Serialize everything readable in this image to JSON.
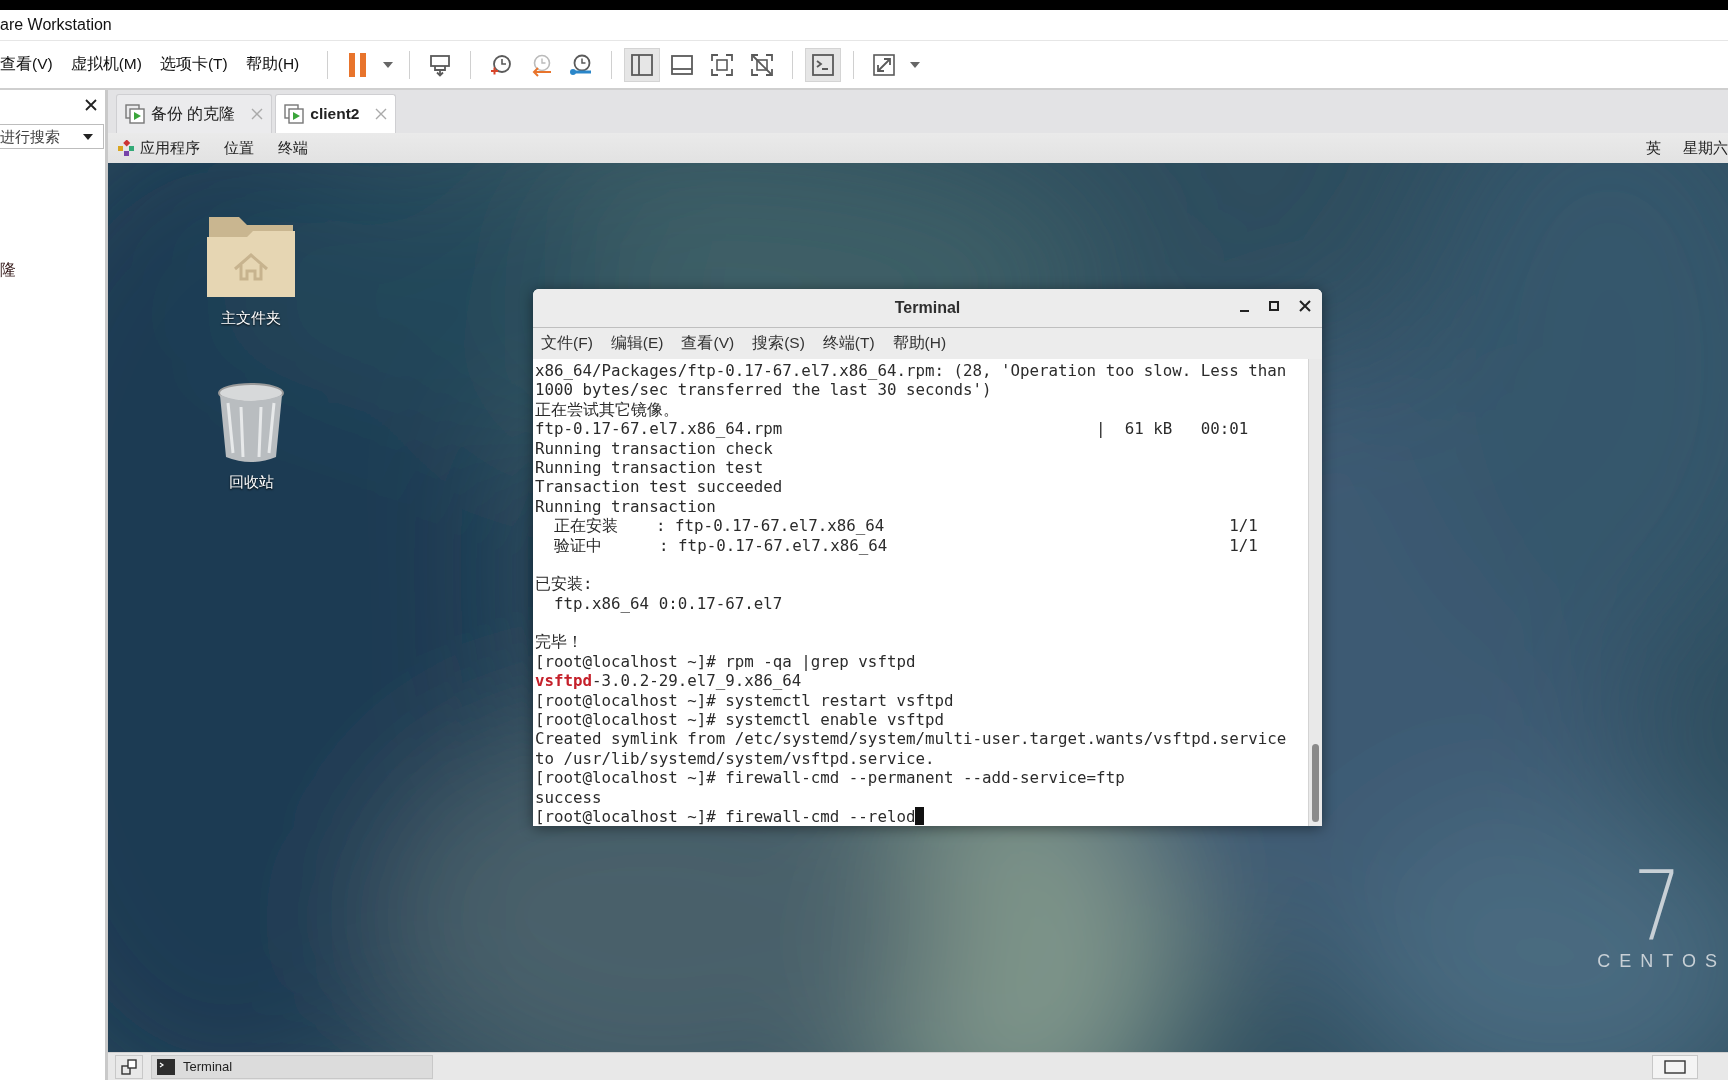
{
  "window": {
    "title": "are Workstation"
  },
  "menu": [
    {
      "label": "查看(V)"
    },
    {
      "label": "虚拟机(M)"
    },
    {
      "label": "选项卡(T)"
    },
    {
      "label": "帮助(H)"
    }
  ],
  "toolbar": {
    "groups": [
      [
        {
          "kind": "pause",
          "selected": false
        },
        {
          "kind": "dropdown",
          "selected": false
        }
      ],
      [
        {
          "kind": "sendkeys",
          "selected": false
        }
      ],
      [
        {
          "kind": "snaptake",
          "selected": false
        },
        {
          "kind": "snaprevert",
          "selected": false
        },
        {
          "kind": "snapmanage",
          "selected": false
        }
      ],
      [
        {
          "kind": "library",
          "selected": true
        },
        {
          "kind": "thumbnails",
          "selected": false
        },
        {
          "kind": "fullscreen",
          "selected": false
        },
        {
          "kind": "unity",
          "selected": false
        }
      ],
      [
        {
          "kind": "console",
          "selected": true
        }
      ],
      [
        {
          "kind": "stretch",
          "selected": false
        },
        {
          "kind": "dropdown",
          "selected": false
        }
      ]
    ]
  },
  "sidebar": {
    "search": {
      "placeholder": "进行搜索"
    },
    "items": [
      {
        "label": "隆"
      }
    ]
  },
  "tabs": [
    {
      "label": "备份 的克隆",
      "selected": false
    },
    {
      "label": "client2",
      "selected": true
    }
  ],
  "guest": {
    "topbar": {
      "menus": [
        {
          "label": "应用程序"
        },
        {
          "label": "位置"
        },
        {
          "label": "终端"
        }
      ],
      "status": [
        {
          "label": "英"
        },
        {
          "label": "星期六"
        }
      ]
    },
    "desktop": {
      "icons": [
        {
          "kind": "home",
          "label": "主文件夹"
        },
        {
          "kind": "trash",
          "label": "回收站"
        }
      ],
      "logo": {
        "number": "7",
        "name": "CENTOS"
      }
    },
    "terminal": {
      "title": "Terminal",
      "cursor": true,
      "menus": [
        {
          "label": "文件(F)"
        },
        {
          "label": "编辑(E)"
        },
        {
          "label": "查看(V)"
        },
        {
          "label": "搜索(S)"
        },
        {
          "label": "终端(T)"
        },
        {
          "label": "帮助(H)"
        }
      ],
      "lines": [
        {
          "kind": "text",
          "text": "x86_64/Packages/ftp-0.17-67.el7.x86_64.rpm: (28, 'Operation too slow. Less than"
        },
        {
          "kind": "text",
          "text": "1000 bytes/sec transferred the last 30 seconds')"
        },
        {
          "kind": "text",
          "text": "正在尝试其它镜像。"
        },
        {
          "kind": "text",
          "text": "ftp-0.17-67.el7.x86_64.rpm                                 |  61 kB   00:01"
        },
        {
          "kind": "text",
          "text": "Running transaction check"
        },
        {
          "kind": "text",
          "text": "Running transaction test"
        },
        {
          "kind": "text",
          "text": "Transaction test succeeded"
        },
        {
          "kind": "text",
          "text": "Running transaction"
        },
        {
          "kind": "text",
          "text": "  正在安装    : ftp-0.17-67.el7.x86_64",
          "right": "1/1"
        },
        {
          "kind": "text",
          "text": "  验证中      : ftp-0.17-67.el7.x86_64",
          "right": "1/1"
        },
        {
          "kind": "blank"
        },
        {
          "kind": "text",
          "text": "已安装:"
        },
        {
          "kind": "text",
          "text": "  ftp.x86_64 0:0.17-67.el7"
        },
        {
          "kind": "blank"
        },
        {
          "kind": "text",
          "text": "完毕！"
        },
        {
          "kind": "text",
          "text": "[root@localhost ~]# rpm -qa |grep vsftpd"
        },
        {
          "kind": "match",
          "segments": [
            {
              "text": "vsftpd",
              "match": true
            },
            {
              "text": "-3.0.2-29.el7_9.x86_64",
              "match": false
            }
          ]
        },
        {
          "kind": "text",
          "text": "[root@localhost ~]# systemctl restart vsftpd"
        },
        {
          "kind": "text",
          "text": "[root@localhost ~]# systemctl enable vsftpd"
        },
        {
          "kind": "text",
          "text": "Created symlink from /etc/systemd/system/multi-user.target.wants/vsftpd.service"
        },
        {
          "kind": "text",
          "text": "to /usr/lib/systemd/system/vsftpd.service."
        },
        {
          "kind": "text",
          "text": "[root@localhost ~]# firewall-cmd --permanent --add-service=ftp"
        },
        {
          "kind": "text",
          "text": "success"
        },
        {
          "kind": "text",
          "text": "[root@localhost ~]# firewall-cmd --relod"
        }
      ]
    },
    "taskbar": {
      "tasks": [
        {
          "label": "Terminal",
          "selected": false
        }
      ]
    }
  }
}
